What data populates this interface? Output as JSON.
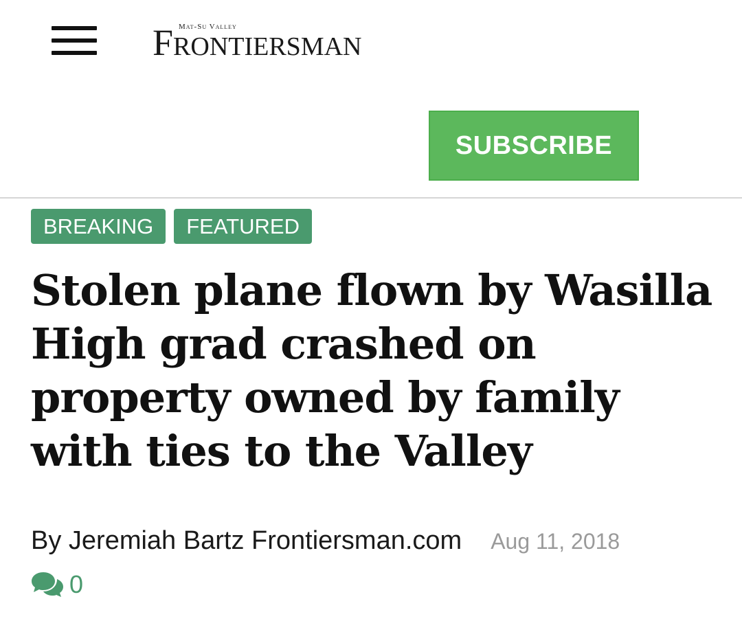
{
  "header": {
    "logo_small": "Mat-Su Valley",
    "logo_main": "Frontiersman",
    "subscribe_label": "SUBSCRIBE",
    "menu_icon": "hamburger-menu-icon"
  },
  "tags": [
    {
      "label": "BREAKING"
    },
    {
      "label": "FEATURED"
    }
  ],
  "article": {
    "headline": "Stolen plane flown by Wasilla High grad crashed on property owned by family with ties to the Valley",
    "byline": "By Jeremiah Bartz Frontiersman.com",
    "date": "Aug 11, 2018",
    "comment_count": "0",
    "comment_icon": "comments-icon"
  },
  "colors": {
    "subscribe_bg": "#5cb85c",
    "tag_bg": "#4a9a6e",
    "date_text": "#9a9a9a"
  }
}
